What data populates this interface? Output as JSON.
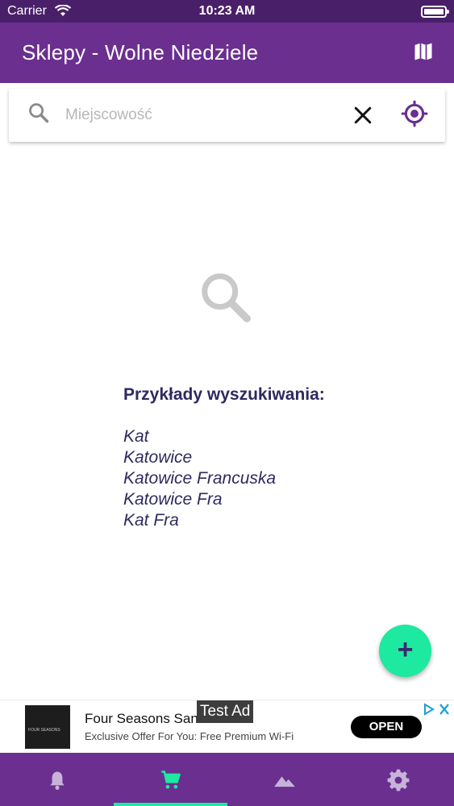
{
  "status_bar": {
    "carrier": "Carrier",
    "time": "10:23 AM"
  },
  "app_bar": {
    "title": "Sklepy - Wolne Niedziele",
    "map_icon": "map-icon"
  },
  "search": {
    "placeholder": "Miejscowość",
    "value": "",
    "icons": [
      "search-icon",
      "close-icon",
      "crosshair-location-icon"
    ]
  },
  "empty_state": {
    "icon": "search-icon",
    "heading": "Przykłady wyszukiwania:",
    "examples": [
      "Kat",
      "Katowice",
      "Katowice Francuska",
      "Katowice Fra",
      "Kat Fra"
    ]
  },
  "fab": {
    "label": "+",
    "color": "#1de9a0"
  },
  "ad": {
    "badge": "Test Ad",
    "title": "Four Seasons San",
    "subtitle": "Exclusive Offer For You: Free Premium Wi-Fi",
    "cta": "OPEN",
    "logo_text": "FOUR SEASONS"
  },
  "bottom_nav": {
    "tabs": [
      {
        "icon": "bell-icon",
        "active": false
      },
      {
        "icon": "cart-icon",
        "active": true
      },
      {
        "icon": "mountains-icon",
        "active": false
      },
      {
        "icon": "gear-icon",
        "active": false
      }
    ],
    "active_color": "#1de9a0"
  },
  "colors": {
    "primary": "#6a2f8f",
    "status_bar": "#4a1f6a",
    "accent": "#1de9a0",
    "text_dark": "#2e2a5e"
  }
}
